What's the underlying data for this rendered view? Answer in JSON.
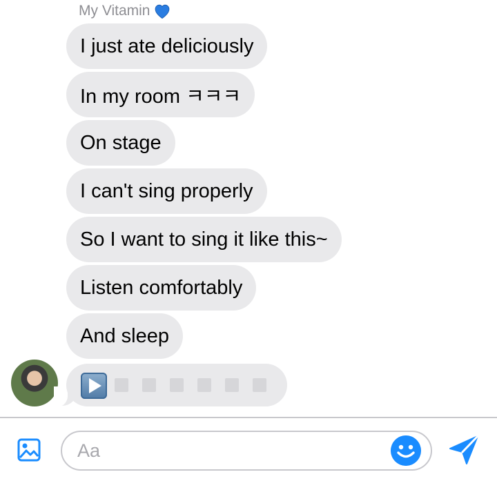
{
  "conversation": {
    "sender_name": "My Vitamin",
    "sender_emoji": "💙",
    "messages": [
      {
        "text": "I just ate deliciously"
      },
      {
        "text": "In my room ㅋㅋㅋ"
      },
      {
        "text": "On stage"
      },
      {
        "text": "I can't sing properly"
      },
      {
        "text": "So I want to sing it like this~"
      },
      {
        "text": "Listen comfortably"
      },
      {
        "text": "And sleep"
      }
    ],
    "audio_message": {
      "play_icon": "play-icon",
      "waveform_segments": 6
    }
  },
  "composer": {
    "placeholder": "Aa",
    "image_icon": "image-icon",
    "emoji_icon": "smiley-icon",
    "send_icon": "send-icon"
  },
  "colors": {
    "bubble_gray": "#e9e9eb",
    "accent_blue": "#1a8cff",
    "placeholder_gray": "#a8a8ad"
  }
}
